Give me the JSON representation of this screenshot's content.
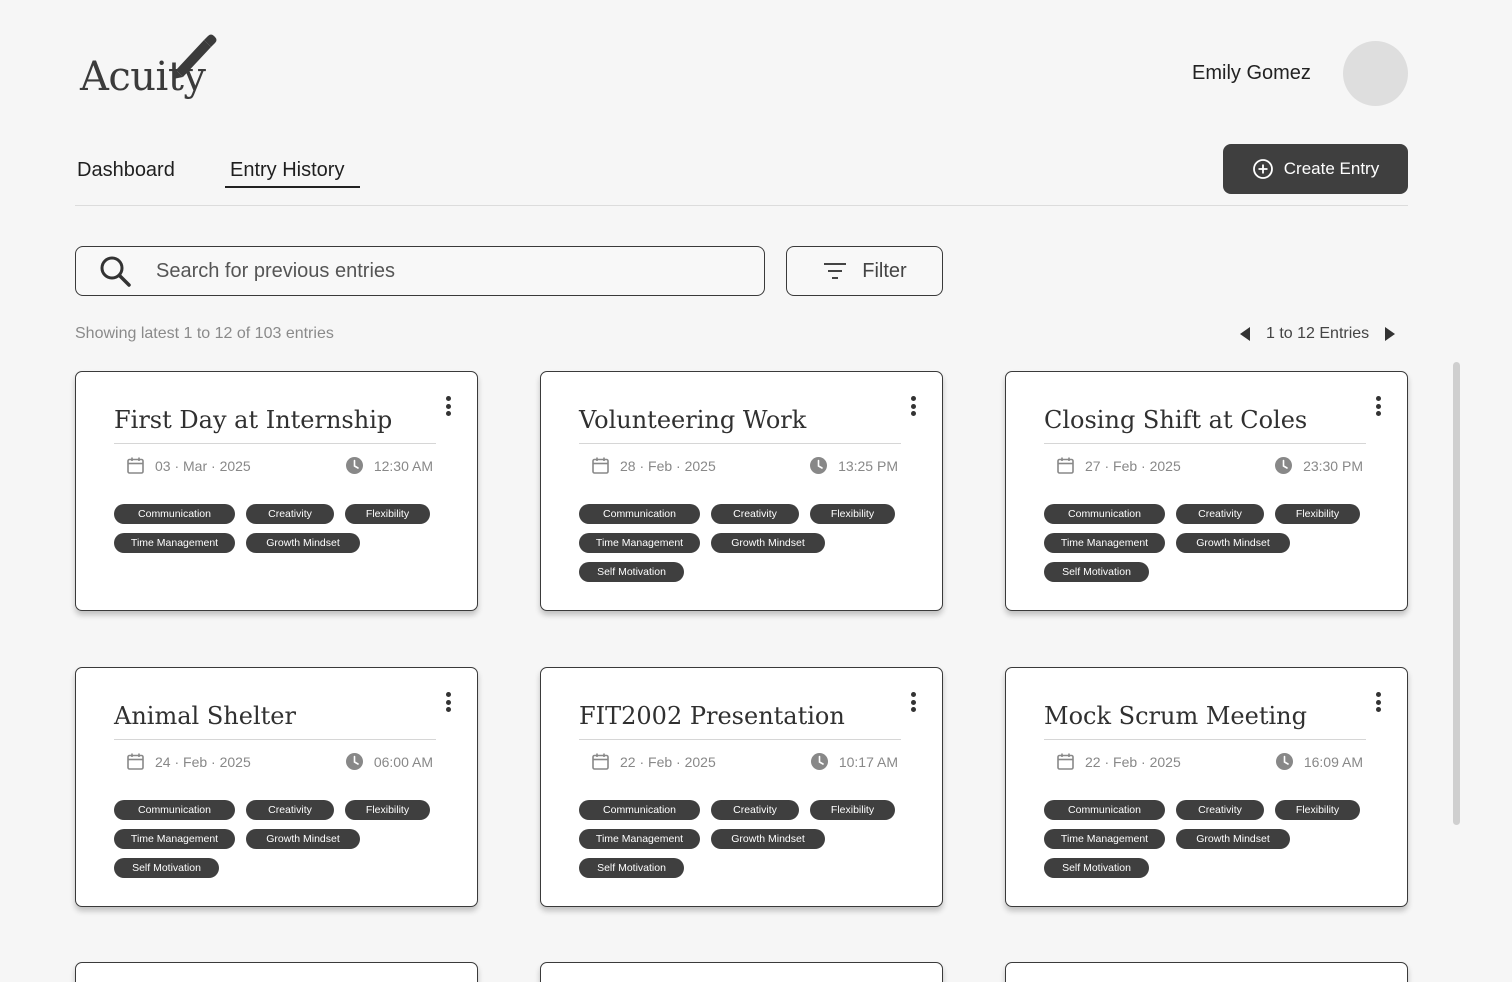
{
  "header": {
    "logo_text": "Acuity",
    "user_name": "Emily Gomez",
    "tabs": [
      {
        "label": "Dashboard",
        "active": false
      },
      {
        "label": "Entry History",
        "active": true
      }
    ],
    "create_entry_label": "Create Entry"
  },
  "search": {
    "placeholder": "Search for previous entries",
    "value": "",
    "filter_label": "Filter"
  },
  "listing": {
    "showing_text": "Showing latest 1 to 12 of 103 entries",
    "pager_text": "1 to 12 Entries"
  },
  "entries": [
    {
      "title": "First Day at Internship",
      "date": "03 · Mar · 2025",
      "time": "12:30 AM",
      "tags": [
        "Communication",
        "Creativity",
        "Flexibility",
        "Time Management",
        "Growth Mindset"
      ]
    },
    {
      "title": "Volunteering Work",
      "date": "28 · Feb · 2025",
      "time": "13:25 PM",
      "tags": [
        "Communication",
        "Creativity",
        "Flexibility",
        "Time Management",
        "Growth Mindset",
        "Self Motivation"
      ]
    },
    {
      "title": "Closing Shift at Coles",
      "date": "27 · Feb · 2025",
      "time": "23:30 PM",
      "tags": [
        "Communication",
        "Creativity",
        "Flexibility",
        "Time Management",
        "Growth Mindset",
        "Self Motivation"
      ]
    },
    {
      "title": "Animal Shelter",
      "date": "24 · Feb · 2025",
      "time": "06:00 AM",
      "tags": [
        "Communication",
        "Creativity",
        "Flexibility",
        "Time Management",
        "Growth Mindset",
        "Self Motivation"
      ]
    },
    {
      "title": "FIT2002 Presentation",
      "date": "22 · Feb · 2025",
      "time": "10:17 AM",
      "tags": [
        "Communication",
        "Creativity",
        "Flexibility",
        "Time Management",
        "Growth Mindset",
        "Self Motivation"
      ]
    },
    {
      "title": "Mock Scrum Meeting",
      "date": "22 · Feb · 2025",
      "time": "16:09 AM",
      "tags": [
        "Communication",
        "Creativity",
        "Flexibility",
        "Time Management",
        "Growth Mindset",
        "Self Motivation"
      ]
    }
  ],
  "colors": {
    "background": "#f6f6f6",
    "accent_dark": "#3f3f3f",
    "muted_text": "#888888"
  },
  "icons": [
    "pen-icon",
    "plus-circle-icon",
    "search-icon",
    "filter-icon",
    "arrow-left-icon",
    "arrow-right-icon",
    "calendar-icon",
    "clock-icon",
    "kebab-menu-icon"
  ]
}
